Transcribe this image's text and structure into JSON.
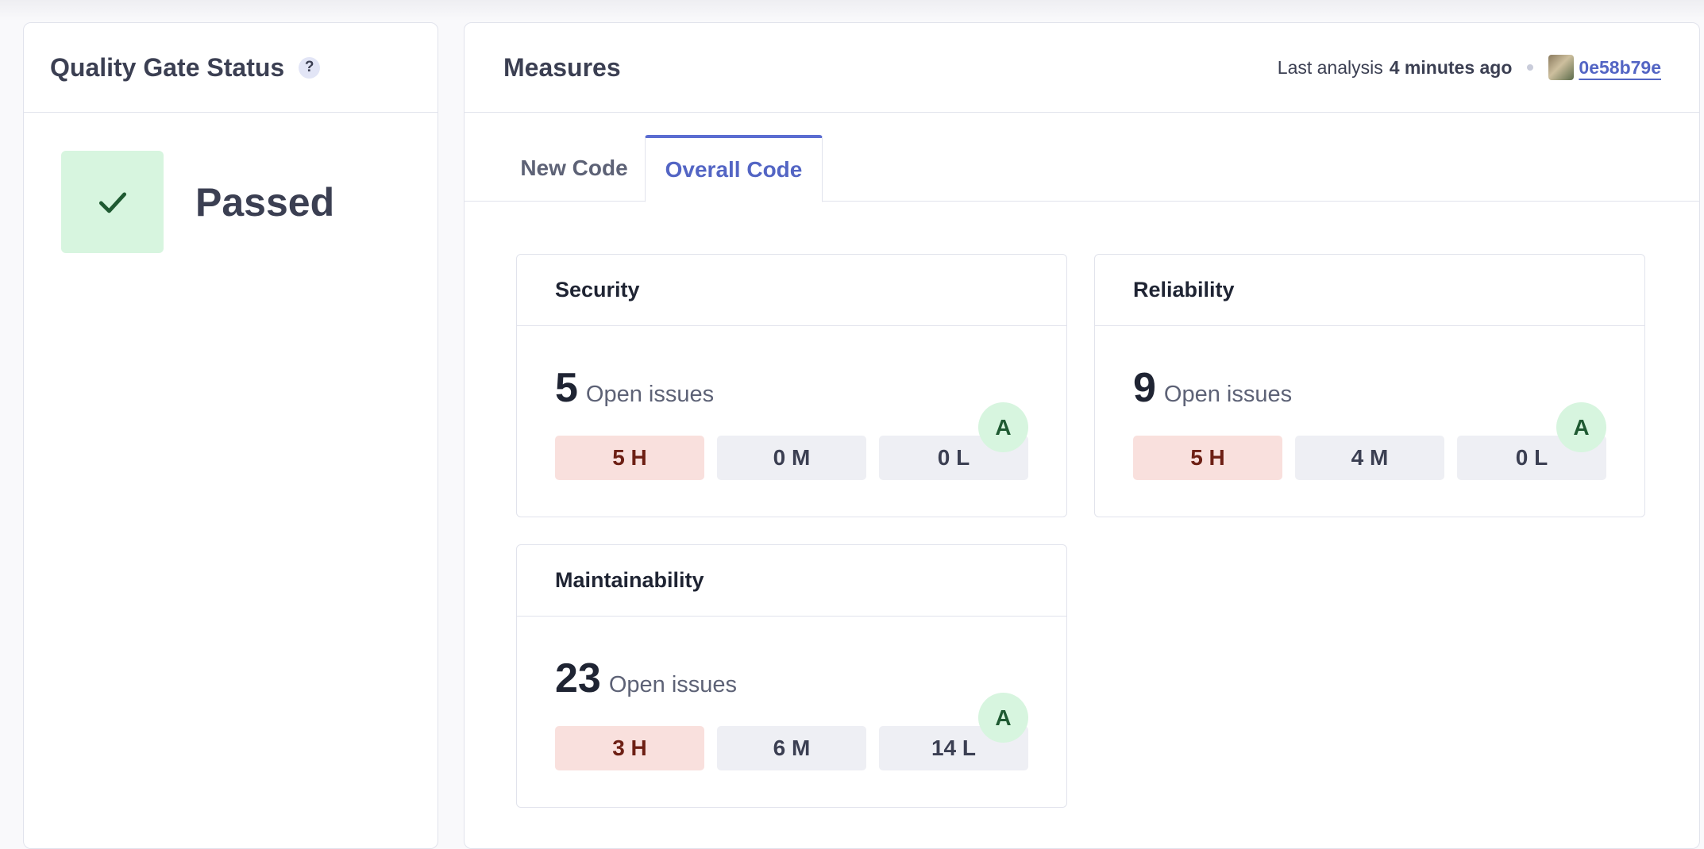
{
  "quality_gate": {
    "title": "Quality Gate Status",
    "help_label": "?",
    "status": "Passed",
    "status_color": "#d7f5df"
  },
  "measures": {
    "title": "Measures",
    "last_analysis_label": "Last analysis",
    "last_analysis_time": "4 minutes ago",
    "commit": "0e58b79e",
    "tabs": [
      {
        "label": "New Code",
        "selected": false
      },
      {
        "label": "Overall Code",
        "selected": true
      }
    ],
    "issues_label": "Open issues",
    "cards": [
      {
        "title": "Security",
        "count": "5",
        "rating": "A",
        "high": "5 H",
        "medium": "0 M",
        "low": "0 L"
      },
      {
        "title": "Reliability",
        "count": "9",
        "rating": "A",
        "high": "5 H",
        "medium": "4 M",
        "low": "0 L"
      },
      {
        "title": "Maintainability",
        "count": "23",
        "rating": "A",
        "high": "3 H",
        "medium": "6 M",
        "low": "14 L"
      }
    ]
  },
  "colors": {
    "accent": "#5365c4",
    "high_bg": "#f9e0dd",
    "rating_bg": "#d7f5df"
  }
}
